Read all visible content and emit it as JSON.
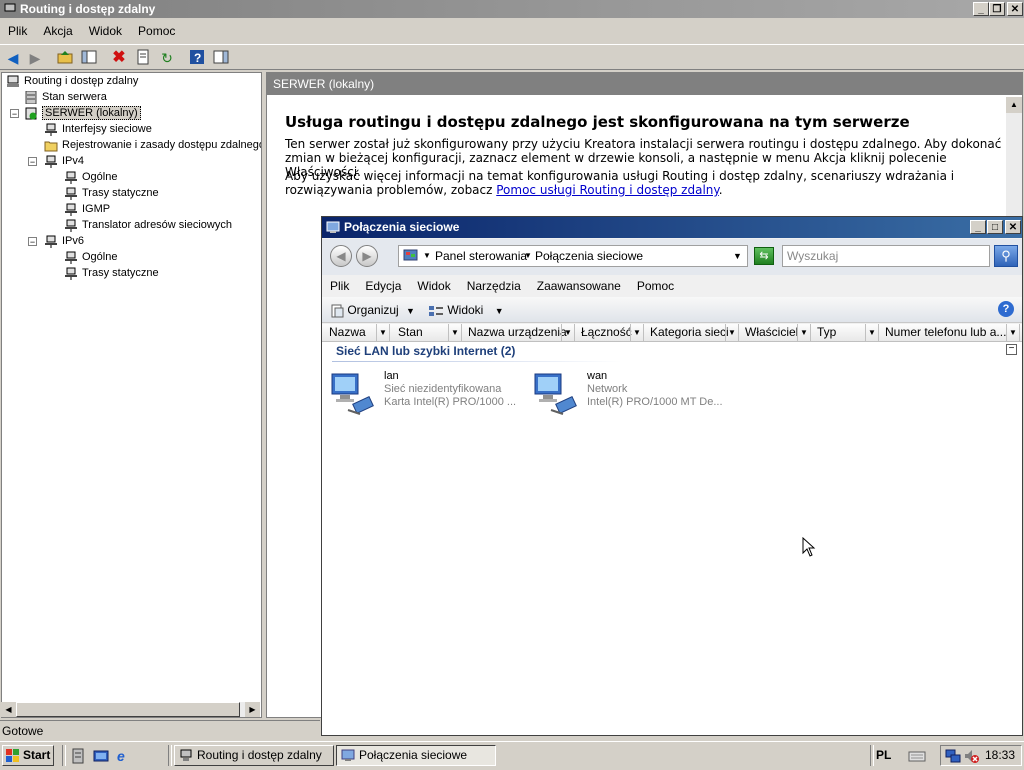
{
  "main_window": {
    "title": "Routing i dostęp zdalny",
    "menu": [
      "Plik",
      "Akcja",
      "Widok",
      "Pomoc"
    ],
    "controls": {
      "minimize": "_",
      "restore": "❐",
      "close": "✕"
    }
  },
  "tree": {
    "items": [
      {
        "label": "Routing i dostęp zdalny",
        "icon": "server-icon"
      },
      {
        "label": "Stan serwera",
        "icon": "server-status-icon"
      },
      {
        "label": "SERWER (lokalny)",
        "icon": "server-running-icon",
        "expander": "−"
      },
      {
        "label": "Interfejsy sieciowe",
        "icon": "interfaces-icon"
      },
      {
        "label": "Rejestrowanie i zasady dostępu zdalnego",
        "icon": "folder-icon"
      },
      {
        "label": "IPv4",
        "icon": "protocol-icon",
        "expander": "−"
      },
      {
        "label": "Ogólne",
        "icon": "protocol-icon"
      },
      {
        "label": "Trasy statyczne",
        "icon": "protocol-icon"
      },
      {
        "label": "IGMP",
        "icon": "protocol-icon"
      },
      {
        "label": "Translator adresów sieciowych",
        "icon": "protocol-icon"
      },
      {
        "label": "IPv6",
        "icon": "protocol-icon",
        "expander": "−"
      },
      {
        "label": "Ogólne",
        "icon": "protocol-icon"
      },
      {
        "label": "Trasy statyczne",
        "icon": "protocol-icon"
      }
    ]
  },
  "right_pane": {
    "header": "SERWER (lokalny)",
    "heading": "Usługa routingu i dostępu zdalnego jest skonfigurowana na tym serwerze",
    "para1": "Ten serwer został już skonfigurowany przy użyciu Kreatora instalacji serwera routingu i dostępu zdalnego. Aby dokonać zmian w bieżącej konfiguracji, zaznacz element w drzewie konsoli, a następnie w menu Akcja kliknij polecenie Właściwości.",
    "para2_text": "Aby uzyskać więcej informacji na temat konfigurowania usługi Routing i dostęp zdalny, scenariuszy wdrażania i rozwiązywania problemów, zobacz ",
    "para2_link": "Pomoc usługi Routing i dostęp zdalny",
    "para2_end": "."
  },
  "network_window": {
    "title": "Połączenia sieciowe",
    "breadcrumb": [
      "Panel sterowania",
      "Połączenia sieciowe"
    ],
    "search_placeholder": "Wyszukaj",
    "menu": [
      "Plik",
      "Edycja",
      "Widok",
      "Narzędzia",
      "Zaawansowane",
      "Pomoc"
    ],
    "commands": {
      "organize": "Organizuj",
      "views": "Widoki"
    },
    "columns": [
      "Nazwa",
      "Stan",
      "Nazwa urządzenia",
      "Łączność",
      "Kategoria sieci",
      "Właściciel",
      "Typ",
      "Numer telefonu lub a..."
    ],
    "group_title": "Sieć LAN lub szybki Internet (2)",
    "group_toggle": "−",
    "connections": [
      {
        "name": "lan",
        "status": "Sieć niezidentyfikowana",
        "device": "Karta Intel(R) PRO/1000 ..."
      },
      {
        "name": "wan",
        "status": "Network",
        "device": "Intel(R) PRO/1000 MT De..."
      }
    ]
  },
  "status_bar": {
    "text": "Gotowe"
  },
  "taskbar": {
    "start": "Start",
    "tasks": [
      {
        "label": "Routing i dostęp zdalny",
        "active": false
      },
      {
        "label": "Połączenia sieciowe",
        "active": true
      }
    ],
    "language": "PL",
    "clock": "18:33"
  }
}
